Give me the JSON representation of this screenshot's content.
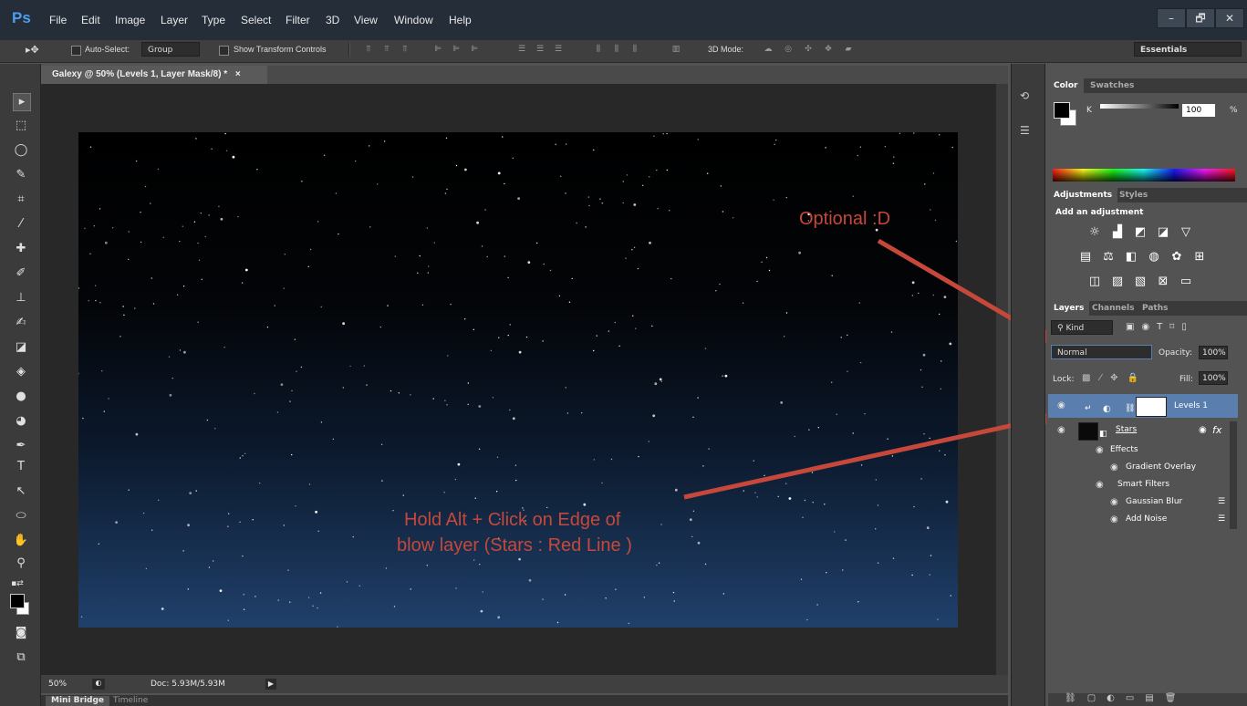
{
  "app": {
    "logo": "Ps",
    "menu": [
      "File",
      "Edit",
      "Image",
      "Layer",
      "Type",
      "Select",
      "Filter",
      "3D",
      "View",
      "Window",
      "Help"
    ],
    "win_min": "–",
    "win_max": "🗗",
    "win_close": "✕"
  },
  "options": {
    "auto_select_label": "Auto-Select:",
    "auto_select_value": "Group",
    "show_transform_label": "Show Transform Controls",
    "mode_label": "3D Mode:",
    "workspace": "Essentials"
  },
  "document": {
    "tab_title": "Galexy @ 50% (Levels 1, Layer Mask/8) *",
    "tab_close": "×",
    "zoom": "50%",
    "doc_info": "Doc: 5.93M/5.93M",
    "annotation_1": "Optional :D",
    "annotation_2_line1": "Hold Alt  + Click on Edge of",
    "annotation_2_line2": "blow layer (Stars : Red Line )"
  },
  "bottom_tabs": [
    "Mini Bridge",
    "Timeline"
  ],
  "color_panel": {
    "tabs": [
      "Color",
      "Swatches"
    ],
    "channel": "K",
    "value": "100",
    "unit": "%"
  },
  "adjustments_panel": {
    "tabs": [
      "Adjustments",
      "Styles"
    ],
    "heading": "Add an adjustment"
  },
  "layers_panel": {
    "tabs": [
      "Layers",
      "Channels",
      "Paths"
    ],
    "filter": "Kind",
    "blend_mode": "Normal",
    "opacity_label": "Opacity:",
    "opacity_value": "100%",
    "lock_label": "Lock:",
    "fill_label": "Fill:",
    "fill_value": "100%",
    "layers": [
      {
        "name": "Levels 1"
      },
      {
        "name": "Stars"
      }
    ],
    "effects_label": "Effects",
    "gradient_overlay": "Gradient Overlay",
    "smart_filters": "Smart Filters",
    "gaussian_blur": "Gaussian Blur",
    "add_noise": "Add Noise",
    "fx": "fx"
  },
  "colors": {
    "accent": "#4d9ef0",
    "annotation": "#c6483a",
    "selected_layer": "#5a7fae"
  }
}
